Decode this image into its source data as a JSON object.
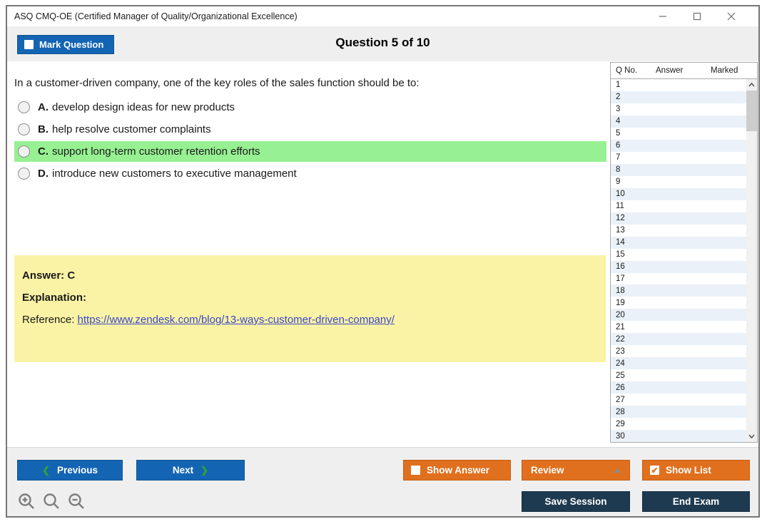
{
  "window": {
    "title": "ASQ CMQ-OE (Certified Manager of Quality/Organizational Excellence)",
    "icons": {
      "minimize": "minimize-dash",
      "maximize": "maximize-square",
      "close": "close-x",
      "previous_chevron": "❮",
      "next_chevron": "❯",
      "review_caret": "caret-up-triangle",
      "zoom_in": "magnifier-plus",
      "zoom_reset": "magnifier",
      "zoom_out": "magnifier-minus",
      "scroll_up": "chevron-up",
      "scroll_down": "chevron-down",
      "check": "✔"
    }
  },
  "header": {
    "mark_question_label": "Mark Question",
    "mark_question_checked": false,
    "question_counter": "Question 5 of 10"
  },
  "question": {
    "text": "In a customer-driven company, one of the key roles of the sales function should be to:",
    "options": [
      {
        "letter": "A.",
        "text": "develop design ideas for new products",
        "highlighted": false
      },
      {
        "letter": "B.",
        "text": "help resolve customer complaints",
        "highlighted": false
      },
      {
        "letter": "C.",
        "text": "support long-term customer retention efforts",
        "highlighted": true
      },
      {
        "letter": "D.",
        "text": "introduce new customers to executive management",
        "highlighted": false
      }
    ]
  },
  "answer_panel": {
    "answer_label": "Answer: C",
    "explanation_label": "Explanation:",
    "reference_label": "Reference:",
    "reference_link": "https://www.zendesk.com/blog/13-ways-customer-driven-company/"
  },
  "question_list": {
    "headers": [
      "Q No.",
      "Answer",
      "Marked"
    ],
    "q_numbers": [
      "1",
      "2",
      "3",
      "4",
      "5",
      "6",
      "7",
      "8",
      "9",
      "10",
      "11",
      "12",
      "13",
      "14",
      "15",
      "16",
      "17",
      "18",
      "19",
      "20",
      "21",
      "22",
      "23",
      "24",
      "25",
      "26",
      "27",
      "28",
      "29",
      "30"
    ]
  },
  "footer": {
    "previous_label": "Previous",
    "next_label": "Next",
    "show_answer_label": "Show Answer",
    "show_answer_checked": false,
    "review_label": "Review",
    "show_list_label": "Show List",
    "show_list_checked": true,
    "save_session_label": "Save Session",
    "end_exam_label": "End Exam"
  },
  "colors": {
    "accent_blue": "#1464b4",
    "accent_orange": "#e0701e",
    "accent_navy": "#1e3a50",
    "highlight_green": "#97f092",
    "answer_yellow": "#faf3a5",
    "row_alt_blue": "#eaf1f8",
    "link_blue": "#3a46c8",
    "chevron_green": "#2ea52c"
  }
}
